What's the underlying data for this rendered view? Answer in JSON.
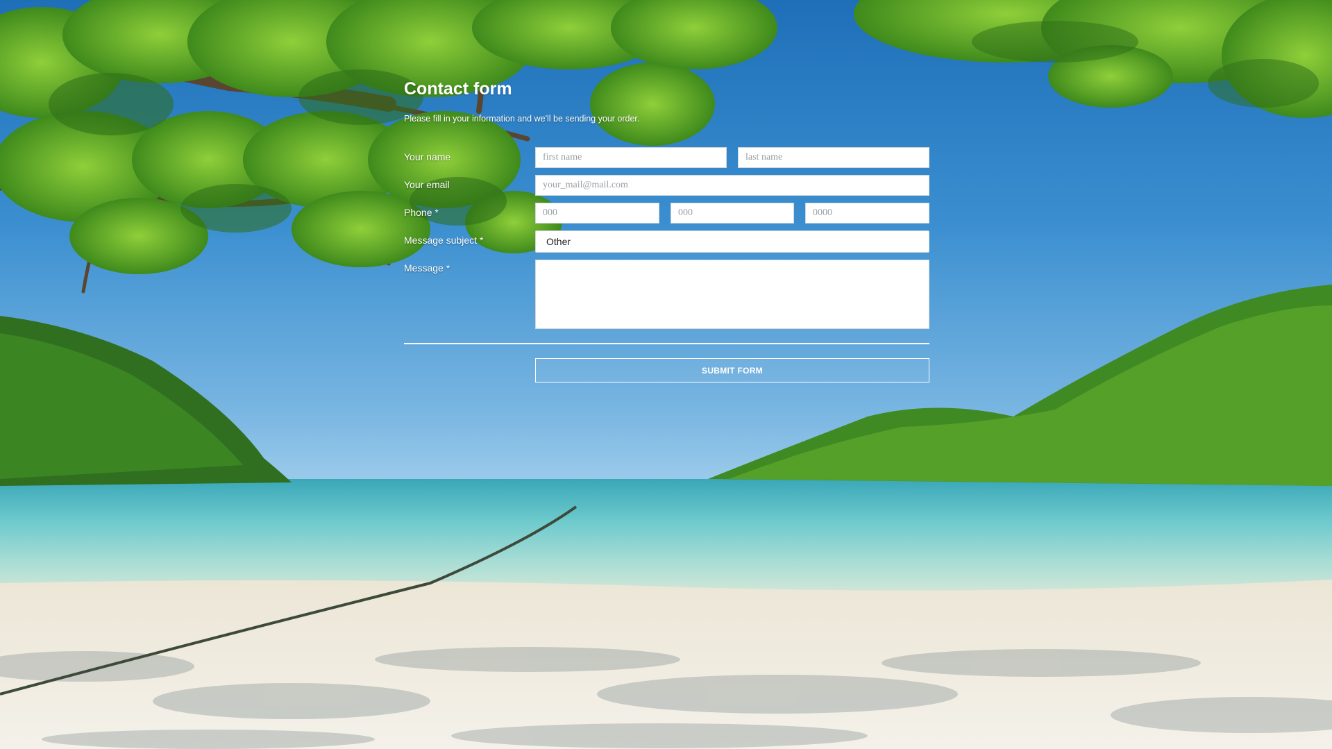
{
  "form": {
    "title": "Contact form",
    "subtitle": "Please fill in your information and we'll be sending your order.",
    "name": {
      "label": "Your name",
      "first_placeholder": "first name",
      "last_placeholder": "last name"
    },
    "email": {
      "label": "Your email",
      "placeholder": "your_mail@mail.com"
    },
    "phone": {
      "label": "Phone *",
      "area_placeholder": "000",
      "prefix_placeholder": "000",
      "line_placeholder": "0000"
    },
    "subject": {
      "label": "Message subject *",
      "selected": "Other"
    },
    "message": {
      "label": "Message *"
    },
    "submit_label": "SUBMIT FORM"
  },
  "colors": {
    "text": "#ffffff",
    "field_background": "#ffffff",
    "placeholder": "#9aa0a6"
  }
}
